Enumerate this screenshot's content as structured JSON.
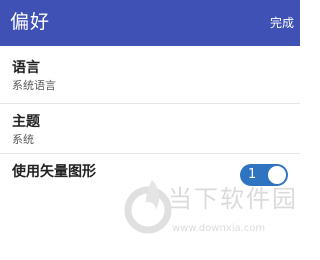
{
  "appbar": {
    "title": "偏好",
    "action_label": "完成",
    "color": "#3f51b5"
  },
  "preferences": [
    {
      "title": "语言",
      "summary": "系统语言"
    },
    {
      "title": "主题",
      "summary": "系统"
    },
    {
      "title": "使用矢量图形",
      "toggle_value": "1",
      "toggle_on": true,
      "toggle_color": "#2f74c0"
    }
  ],
  "watermark": {
    "brand": "当下软件园",
    "url": "www.downxia.com",
    "logo_icon": "downxia-logo-icon"
  }
}
